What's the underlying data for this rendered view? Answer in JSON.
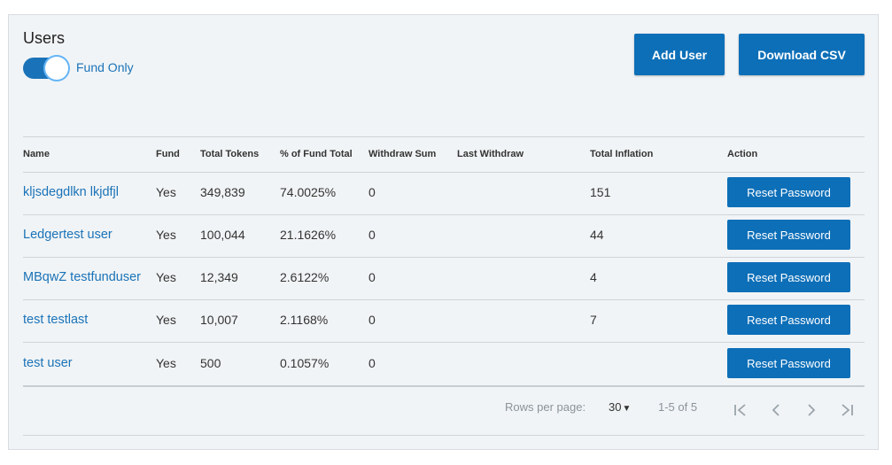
{
  "page": {
    "title": "Users"
  },
  "filter": {
    "label": "Fund Only"
  },
  "actions": {
    "add_user": "Add User",
    "download_csv": "Download CSV"
  },
  "table": {
    "headers": [
      "Name",
      "Fund",
      "Total Tokens",
      "% of Fund Total",
      "Withdraw Sum",
      "Last Withdraw",
      "Total Inflation",
      "Action"
    ],
    "rows": [
      {
        "name": "kljsdegdlkn lkjdfjl",
        "fund": "Yes",
        "total_tokens": "349,839",
        "pct_fund_total": "74.0025%",
        "withdraw_sum": "0",
        "last_withdraw": "",
        "total_inflation": "151",
        "action": "Reset Password"
      },
      {
        "name": "Ledgertest user",
        "fund": "Yes",
        "total_tokens": "100,044",
        "pct_fund_total": "21.1626%",
        "withdraw_sum": "0",
        "last_withdraw": "",
        "total_inflation": "44",
        "action": "Reset Password"
      },
      {
        "name": "MBqwZ testfunduser",
        "fund": "Yes",
        "total_tokens": "12,349",
        "pct_fund_total": "2.6122%",
        "withdraw_sum": "0",
        "last_withdraw": "",
        "total_inflation": "4",
        "action": "Reset Password"
      },
      {
        "name": "test testlast",
        "fund": "Yes",
        "total_tokens": "10,007",
        "pct_fund_total": "2.1168%",
        "withdraw_sum": "0",
        "last_withdraw": "",
        "total_inflation": "7",
        "action": "Reset Password"
      },
      {
        "name": "test user",
        "fund": "Yes",
        "total_tokens": "500",
        "pct_fund_total": "0.1057%",
        "withdraw_sum": "0",
        "last_withdraw": "",
        "total_inflation": "",
        "action": "Reset Password"
      }
    ]
  },
  "pagination": {
    "rows_per_page_label": "Rows per page:",
    "rows_per_page_value": "30",
    "range": "1-5 of 5",
    "icons": [
      "first-page-icon",
      "previous-page-icon",
      "next-page-icon",
      "last-page-icon"
    ]
  },
  "colors": {
    "accent": "#1a73b8",
    "button": "#0d6fb8",
    "card_bg": "#f1f4f6"
  }
}
